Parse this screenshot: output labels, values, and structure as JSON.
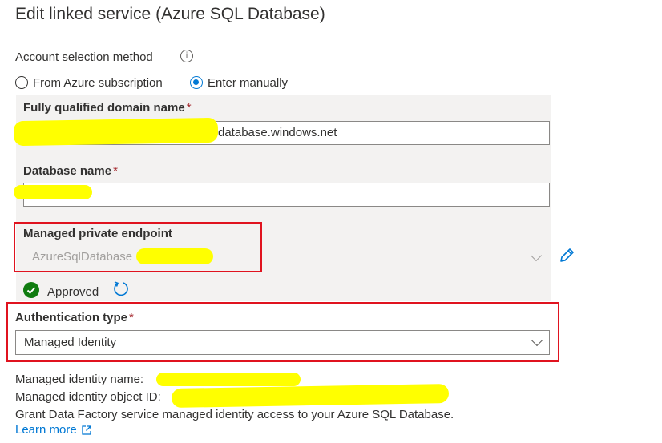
{
  "dialog": {
    "title": "Edit linked service (Azure SQL Database)"
  },
  "account_selection": {
    "label": "Account selection method",
    "info_icon": "info-icon",
    "options": [
      {
        "label": "From Azure subscription",
        "selected": false
      },
      {
        "label": "Enter manually",
        "selected": true
      }
    ]
  },
  "fqdn": {
    "label": "Fully qualified domain name",
    "required_mark": "*",
    "value_suffix": "database.windows.net"
  },
  "database_name": {
    "label": "Database name",
    "required_mark": "*"
  },
  "managed_private_endpoint": {
    "label": "Managed private endpoint",
    "value": "AzureSqlDatabase",
    "edit_icon": "pencil-icon",
    "status": "Approved",
    "status_icon": "check-circle-icon",
    "refresh_icon": "refresh-icon"
  },
  "authentication": {
    "label": "Authentication type",
    "required_mark": "*",
    "value": "Managed Identity"
  },
  "managed_identity": {
    "name_label": "Managed identity name:",
    "object_id_label": "Managed identity object ID:",
    "grant_text": "Grant Data Factory service managed identity access to your Azure SQL Database.",
    "learn_more": "Learn more",
    "external_link_icon": "external-link-icon"
  },
  "colors": {
    "accent": "#0078d4",
    "success": "#107c10",
    "required": "#a4262c",
    "annotation_box": "#e0131f",
    "redaction": "#ffff00"
  }
}
